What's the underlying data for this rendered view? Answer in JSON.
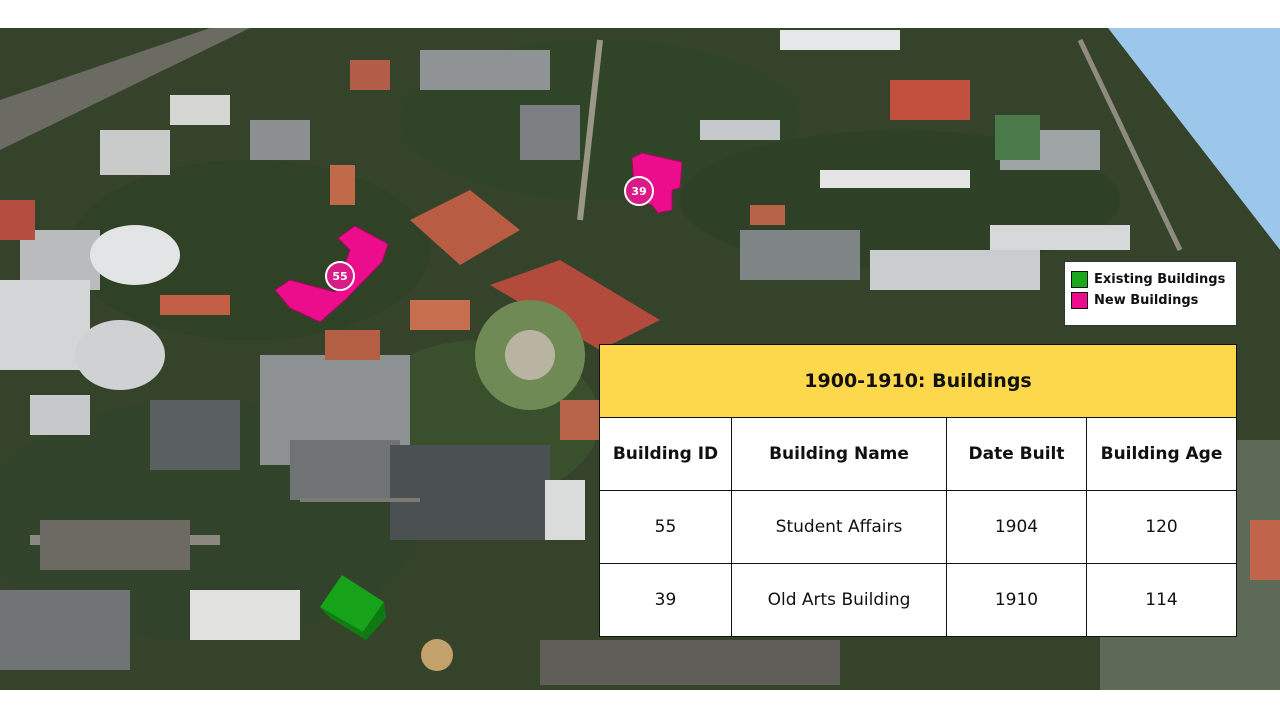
{
  "colors": {
    "new_buildings": "#ec0d8c",
    "existing_buildings": "#1aa81f",
    "table_title_bg": "#fdd84d",
    "sky": "#9cc6ea"
  },
  "legend": {
    "items": [
      {
        "label": "Existing Buildings",
        "color": "#1aa81f"
      },
      {
        "label": "New Buildings",
        "color": "#ec0d8c"
      }
    ]
  },
  "markers": [
    {
      "id": "55"
    },
    {
      "id": "39"
    }
  ],
  "table": {
    "title": "1900-1910: Buildings",
    "headers": [
      "Building ID",
      "Building Name",
      "Date Built",
      "Building Age"
    ],
    "rows": [
      [
        "55",
        "Student Affairs",
        "1904",
        "120"
      ],
      [
        "39",
        "Old Arts Building",
        "1910",
        "114"
      ]
    ]
  }
}
